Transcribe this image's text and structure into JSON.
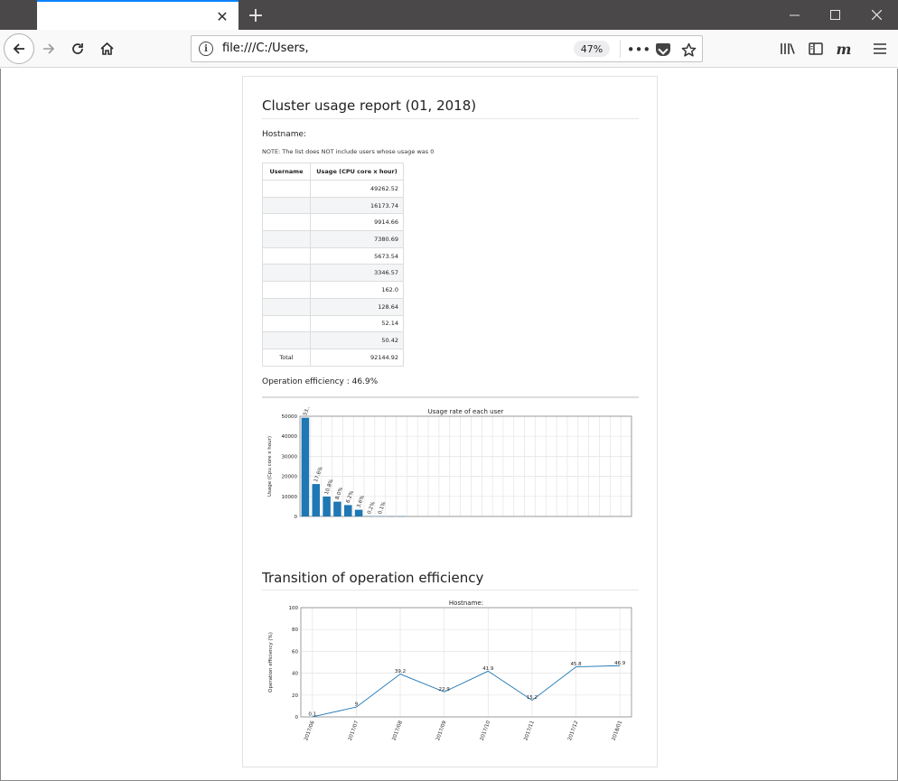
{
  "browser": {
    "tab_title": "",
    "url": "file:///C:/Users,",
    "zoom": "47%"
  },
  "report": {
    "title": "Cluster usage report (01, 2018)",
    "hostname_label": "Hostname:",
    "note": "NOTE: The list does NOT include users whose usage was 0",
    "table": {
      "headers": [
        "Username",
        "Usage (CPU core x hour)"
      ],
      "rows": [
        {
          "user": "",
          "usage": "49262.52"
        },
        {
          "user": "",
          "usage": "16173.74"
        },
        {
          "user": "",
          "usage": "9914.66"
        },
        {
          "user": "",
          "usage": "7380.69"
        },
        {
          "user": "",
          "usage": "5673.54"
        },
        {
          "user": "",
          "usage": "3346.57"
        },
        {
          "user": "",
          "usage": "162.0"
        },
        {
          "user": "",
          "usage": "128.64"
        },
        {
          "user": "",
          "usage": "52.14"
        },
        {
          "user": "",
          "usage": "50.42"
        }
      ],
      "total_label": "Total",
      "total_value": "92144.92"
    },
    "operation_efficiency": "Operation efficiency : 46.9%",
    "transition_title": "Transition of operation efficiency"
  },
  "chart_data": [
    {
      "type": "bar",
      "title": "Usage rate of each user",
      "xlabel": "",
      "ylabel": "Usage (Cpu core x hour)",
      "ylim": [
        0,
        50000
      ],
      "yticks": [
        0,
        10000,
        20000,
        30000,
        40000,
        50000
      ],
      "grid": true,
      "color": "#1f77b4",
      "values": [
        49262.52,
        16173.74,
        9914.66,
        7380.69,
        5673.54,
        3346.57,
        162.0,
        128.64,
        52.14,
        50.42
      ],
      "labels": [
        "53.5%",
        "17.6%",
        "10.8%",
        "8.0%",
        "6.2%",
        "3.6%",
        "0.2%",
        "0.1%",
        "",
        ""
      ]
    },
    {
      "type": "line",
      "title": "Hostname:",
      "xlabel": "",
      "ylabel": "Operation efficiency (%)",
      "ylim": [
        0,
        100
      ],
      "yticks": [
        0,
        20,
        40,
        60,
        80,
        100
      ],
      "grid": true,
      "color": "#1f77b4",
      "x": [
        "2017/06",
        "2017/07",
        "2017/08",
        "2017/09",
        "2017/10",
        "2017/11",
        "2017/12",
        "2018/01"
      ],
      "values": [
        0.1,
        9.0,
        39.2,
        22.9,
        41.9,
        15.2,
        45.8,
        46.9
      ]
    }
  ]
}
